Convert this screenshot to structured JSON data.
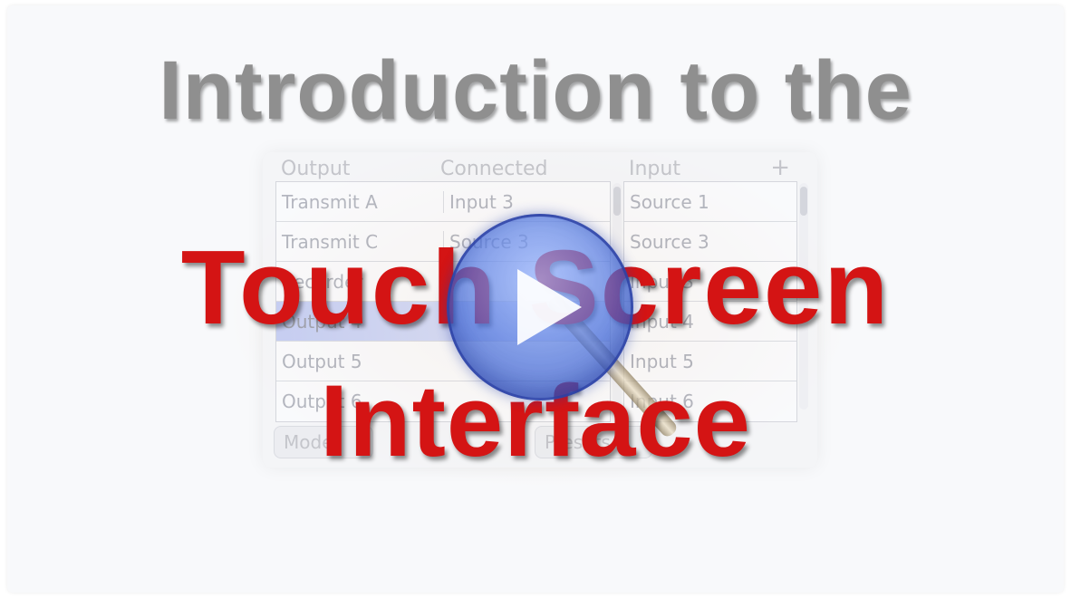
{
  "video": {
    "title_line1": "Introduction to the",
    "title_line2": "Touch Screen",
    "title_line3": "Interface",
    "play_icon": "play-icon"
  },
  "panel": {
    "headers": {
      "output": "Output",
      "connected": "Connected",
      "input": "Input",
      "add": "+"
    },
    "left_rows": [
      {
        "output": "Transmit A",
        "connected": "Input 3"
      },
      {
        "output": "Transmit C",
        "connected": "Source 3"
      },
      {
        "output": "Recorder",
        "connected": ""
      },
      {
        "output": "Output 4",
        "connected": ""
      },
      {
        "output": "Output 5",
        "connected": ""
      },
      {
        "output": "Output 6",
        "connected": ""
      }
    ],
    "right_rows": [
      "Source 1",
      "Source 3",
      "Input 3",
      "Input 4",
      "Input 5",
      "Input 6"
    ],
    "bottom_buttons": [
      "Mode",
      "Presets"
    ]
  }
}
